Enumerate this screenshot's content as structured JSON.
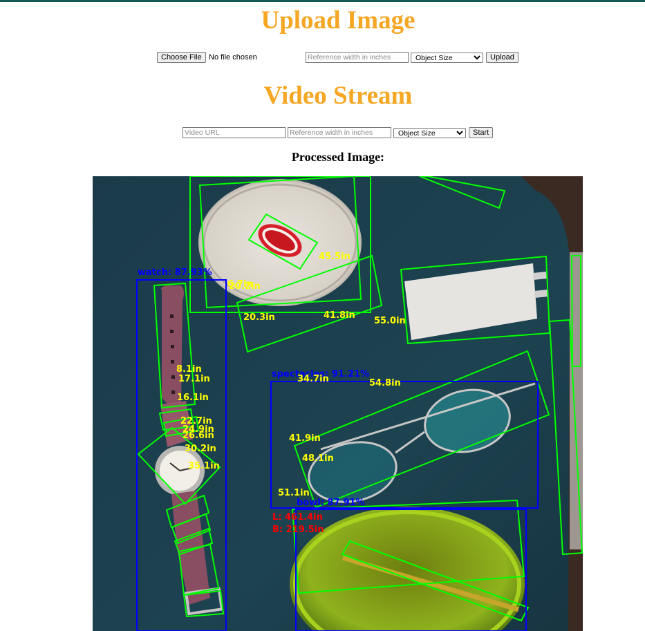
{
  "upload": {
    "title": "Upload Image",
    "choose_file_label": "Choose File",
    "file_status": "No file chosen",
    "reference_width_placeholder": "Reference width in inches",
    "select_value": "Object Size",
    "upload_label": "Upload"
  },
  "video": {
    "title": "Video Stream",
    "url_placeholder": "Video URL",
    "reference_width_placeholder": "Reference width in inches",
    "select_value": "Object Size",
    "start_label": "Start"
  },
  "processed": {
    "title": "Processed Image:",
    "detections": [
      {
        "label": "watch: 87.93%"
      },
      {
        "label": "spectacles: 91.21%"
      },
      {
        "label": "bowl: 87.91%"
      }
    ],
    "measurements": [
      "45.5in",
      "20.3in",
      "41.8in",
      "55.0in",
      "8.1in",
      "17.1in",
      "16.1in",
      "22.7in",
      "24.9in",
      "26.6in",
      "30.2in",
      "35.1in",
      "34.7in",
      "54.8in",
      "41.9in",
      "48.1in",
      "51.1in",
      "20.2in",
      "6.7in"
    ],
    "dimensions": {
      "length": "L: 461.4in",
      "breadth": "B: 219.5in"
    },
    "colors": {
      "contour": "#00ff00",
      "detection_box": "#0000ff",
      "measurement_text": "#ffff00",
      "dimension_text": "#ff0000"
    }
  }
}
